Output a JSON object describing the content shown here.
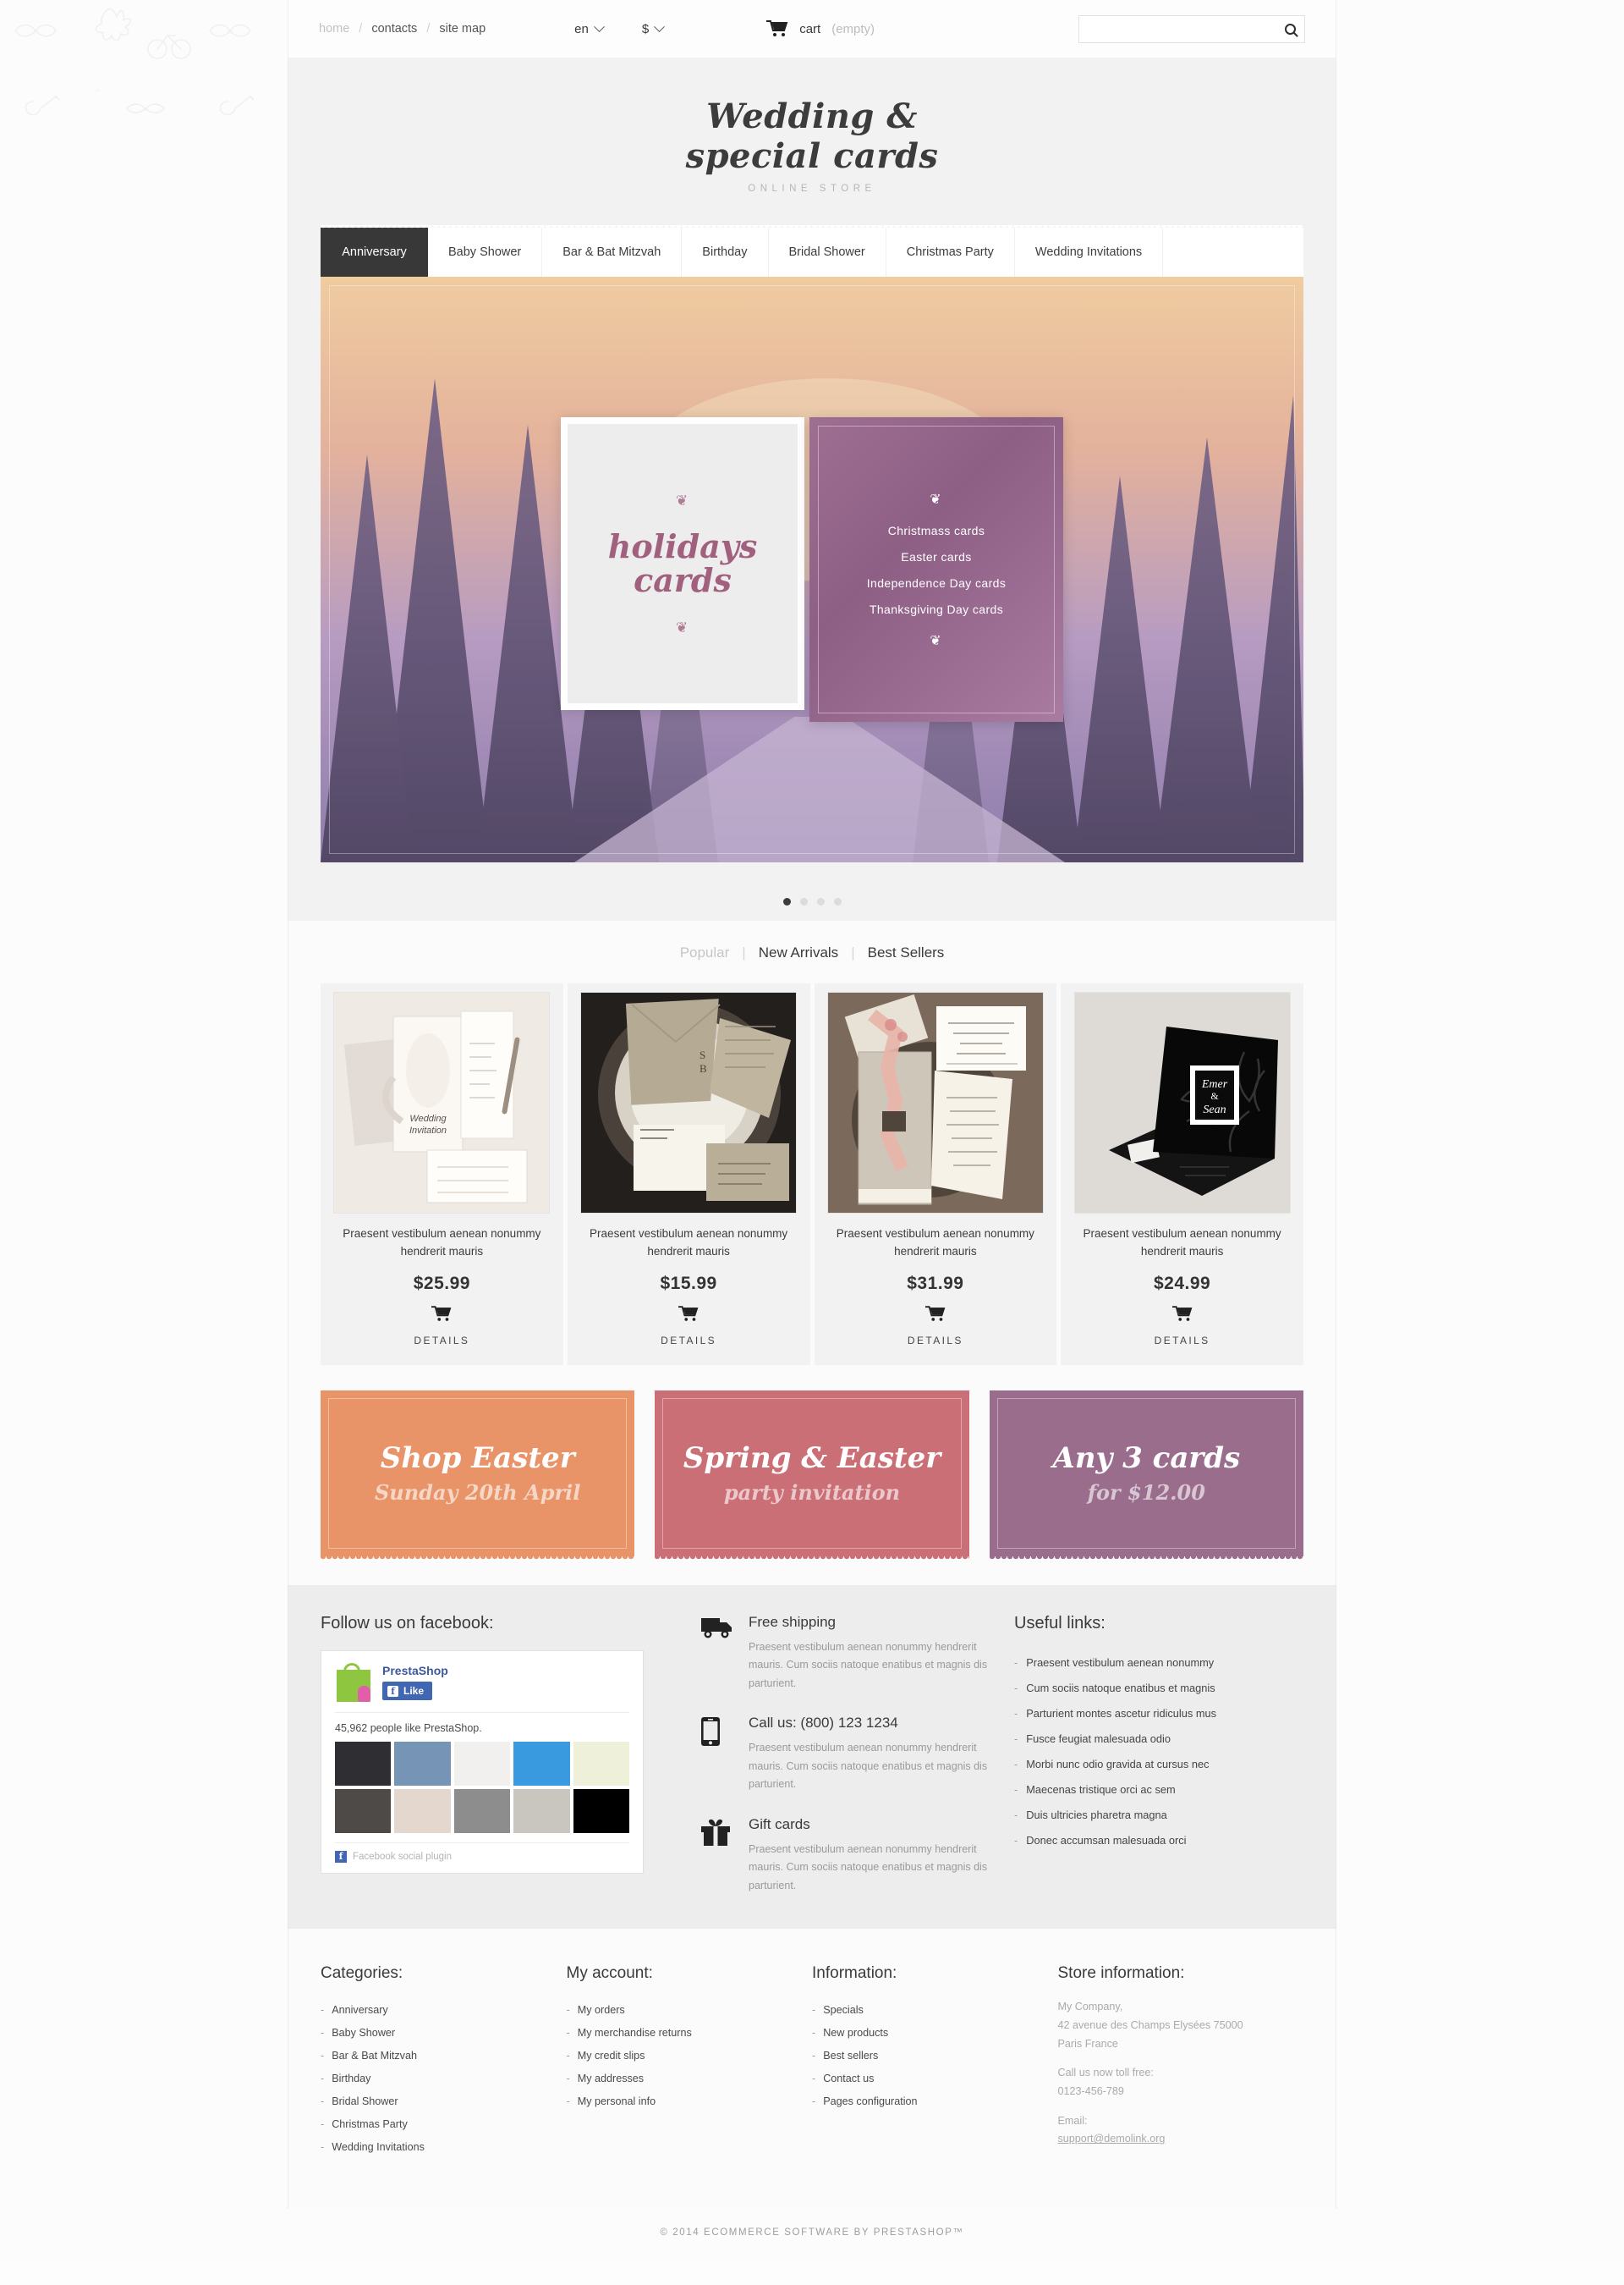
{
  "topbar": {
    "breadcrumbs": [
      {
        "label": "home",
        "muted": true
      },
      {
        "label": "contacts",
        "muted": false
      },
      {
        "label": "site map",
        "muted": false
      }
    ],
    "separator": "/",
    "language": "en",
    "currency": "$",
    "cart_label": "cart",
    "cart_status": "(empty)",
    "search_placeholder": ""
  },
  "header": {
    "logo_line1": "Wedding &",
    "logo_line2": "special cards",
    "tagline": "ONLINE STORE"
  },
  "nav": {
    "items": [
      {
        "label": "Anniversary",
        "active": true
      },
      {
        "label": "Baby Shower",
        "active": false
      },
      {
        "label": "Bar & Bat Mitzvah",
        "active": false
      },
      {
        "label": "Birthday",
        "active": false
      },
      {
        "label": "Bridal Shower",
        "active": false
      },
      {
        "label": "Christmas Party",
        "active": false
      },
      {
        "label": "Wedding Invitations",
        "active": false
      }
    ]
  },
  "hero": {
    "card_title_line1": "holidays",
    "card_title_line2": "cards",
    "ornament": "❦",
    "list": [
      "Christmass cards",
      "Easter cards",
      "Independence Day cards",
      "Thanksgiving Day cards"
    ],
    "slides_total": 4,
    "active_slide": 1,
    "accent_color": "#a1607e",
    "panel_color": "#95668b"
  },
  "products": {
    "tabs": [
      {
        "label": "Popular",
        "active": true
      },
      {
        "label": "New Arrivals",
        "active": false
      },
      {
        "label": "Best Sellers",
        "active": false
      }
    ],
    "divider": "|",
    "items": [
      {
        "name": "Praesent vestibulum aenean nonummy hendrerit mauris",
        "price": "$25.99",
        "details": "DETAILS"
      },
      {
        "name": "Praesent vestibulum aenean nonummy hendrerit mauris",
        "price": "$15.99",
        "details": "DETAILS"
      },
      {
        "name": "Praesent vestibulum aenean nonummy hendrerit mauris",
        "price": "$31.99",
        "details": "DETAILS"
      },
      {
        "name": "Praesent vestibulum aenean nonummy hendrerit mauris",
        "price": "$24.99",
        "details": "DETAILS"
      }
    ]
  },
  "promos": [
    {
      "title": "Shop Easter",
      "subtitle": "Sunday 20th April",
      "color": "#e89468"
    },
    {
      "title": "Spring & Easter",
      "subtitle": "party invitation",
      "color": "#cb6f76"
    },
    {
      "title": "Any 3 cards",
      "subtitle": "for $12.00",
      "color": "#9a6d8c"
    }
  ],
  "facebook": {
    "heading": "Follow us on facebook:",
    "page_name": "PrestaShop",
    "like_label": "Like",
    "like_count": "45,962 people like PrestaShop.",
    "plugin_label": "Facebook social plugin"
  },
  "features": [
    {
      "icon": "truck-icon",
      "title": "Free shipping",
      "text": "Praesent vestibulum aenean nonummy hendrerit mauris. Cum sociis natoque enatibus et magnis dis parturient."
    },
    {
      "icon": "phone-icon",
      "title": "Call us: (800) 123 1234",
      "text": "Praesent vestibulum aenean nonummy hendrerit mauris. Cum sociis natoque enatibus et magnis dis parturient."
    },
    {
      "icon": "gift-icon",
      "title": "Gift cards",
      "text": "Praesent vestibulum aenean nonummy hendrerit mauris. Cum sociis natoque enatibus et magnis dis parturient."
    }
  ],
  "useful_links": {
    "heading": "Useful links:",
    "bullet": "-",
    "items": [
      "Praesent vestibulum aenean nonummy",
      "Cum sociis natoque enatibus et magnis",
      "Parturient montes ascetur ridiculus mus",
      "Fusce feugiat malesuada odio",
      "Morbi nunc odio gravida at cursus nec",
      "Maecenas tristique orci ac sem",
      "Duis ultricies pharetra magna",
      "Donec accumsan malesuada orci"
    ]
  },
  "footer": {
    "bullet": "-",
    "categories": {
      "heading": "Categories:",
      "items": [
        "Anniversary",
        "Baby Shower",
        "Bar & Bat Mitzvah",
        "Birthday",
        "Bridal Shower",
        "Christmas Party",
        "Wedding Invitations"
      ]
    },
    "account": {
      "heading": "My account:",
      "items": [
        "My orders",
        "My merchandise returns",
        "My credit slips",
        "My addresses",
        "My personal info"
      ]
    },
    "information": {
      "heading": "Information:",
      "items": [
        "Specials",
        "New products",
        "Best sellers",
        "Contact us",
        "Pages configuration"
      ]
    },
    "store": {
      "heading": "Store information:",
      "address_line1": "My Company,",
      "address_line2": "42 avenue des Champs Elysées 75000",
      "address_line3": "Paris France",
      "phone_label": "Call us now toll free:",
      "phone": "0123-456-789",
      "email_label": "Email:",
      "email": "support@demolink.org"
    }
  },
  "copyright": "© 2014 ECOMMERCE SOFTWARE BY PRESTASHOP™"
}
